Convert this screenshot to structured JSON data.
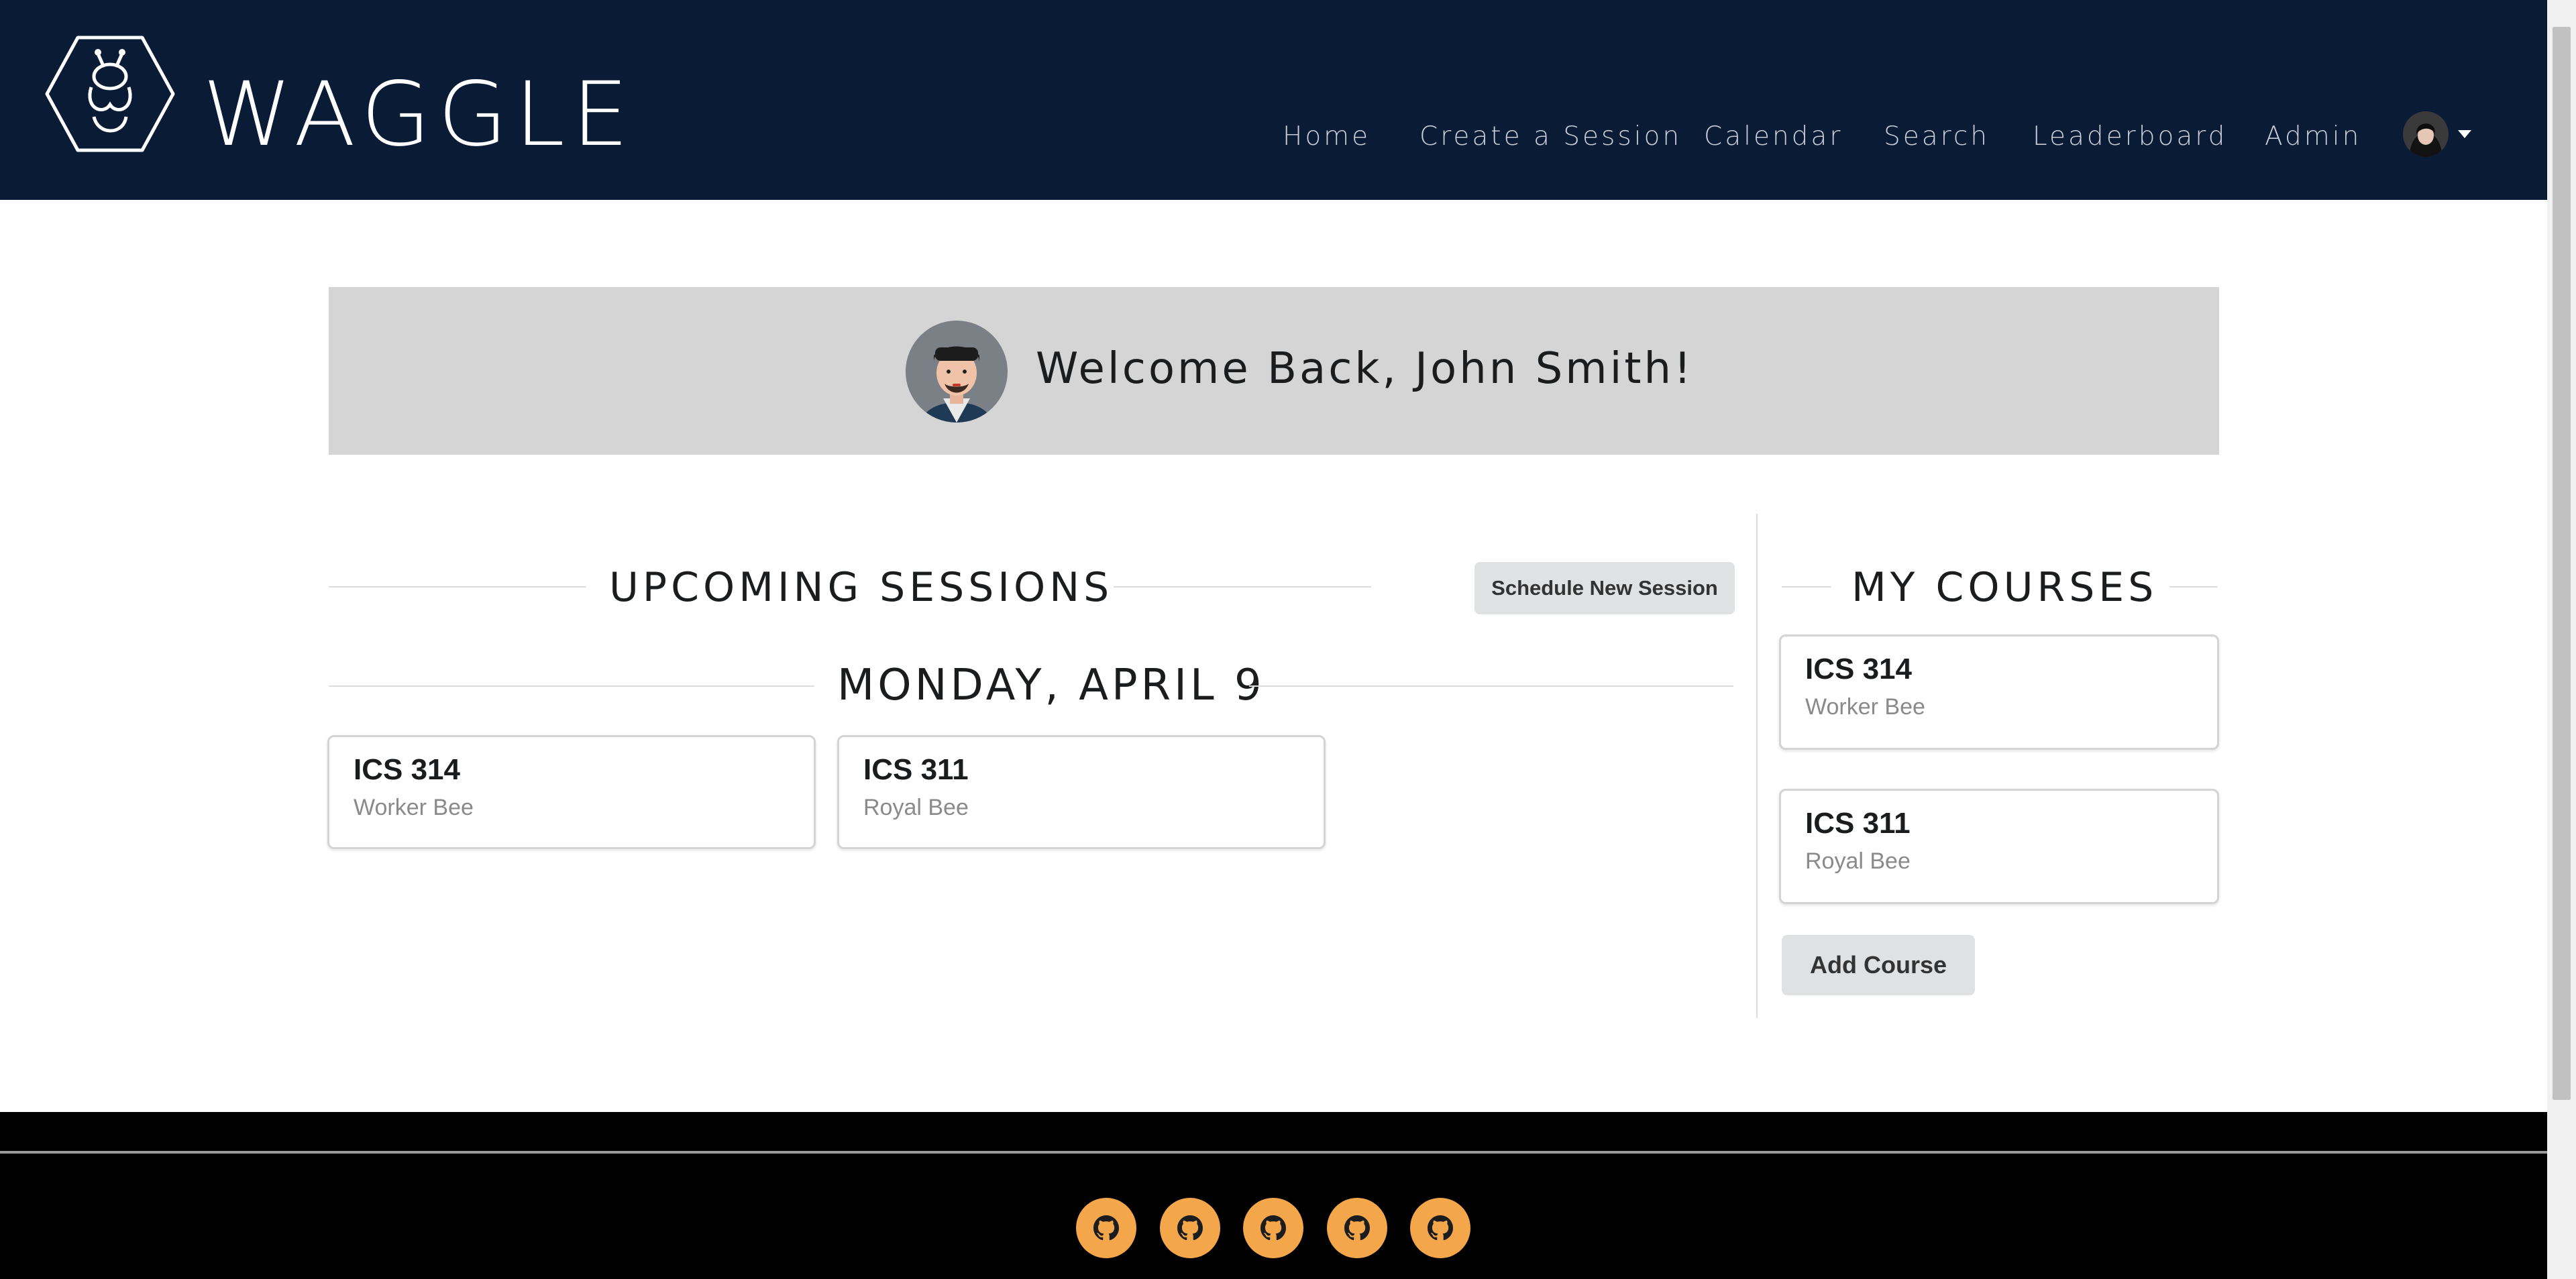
{
  "app": {
    "brand": "WAGGLE",
    "logo_icon": "bee-hexagon-icon",
    "nav_color": "#0a1b35"
  },
  "nav": {
    "items": [
      {
        "label": "Home"
      },
      {
        "label": "Create a Session"
      },
      {
        "label": "Calendar"
      },
      {
        "label": "Search"
      },
      {
        "label": "Leaderboard"
      },
      {
        "label": "Admin"
      }
    ],
    "user_icon": "user-avatar-icon",
    "dropdown_icon": "caret-down-icon"
  },
  "welcome": {
    "text": "Welcome Back, John Smith!",
    "avatar_icon": "profile-avatar-icon"
  },
  "sessions": {
    "title": "UPCOMING SESSIONS",
    "schedule_button": "Schedule New Session",
    "date_heading": "MONDAY, APRIL 9",
    "items": [
      {
        "course": "ICS 314",
        "role": "Worker Bee"
      },
      {
        "course": "ICS 311",
        "role": "Royal Bee"
      }
    ]
  },
  "courses": {
    "title": "MY COURSES",
    "items": [
      {
        "course": "ICS 314",
        "role": "Worker Bee"
      },
      {
        "course": "ICS 311",
        "role": "Royal Bee"
      }
    ],
    "add_button": "Add Course"
  },
  "footer": {
    "link_icons": [
      "github-icon",
      "github-icon",
      "github-icon",
      "github-icon",
      "github-icon"
    ],
    "icon_color": "#f4a64a"
  }
}
